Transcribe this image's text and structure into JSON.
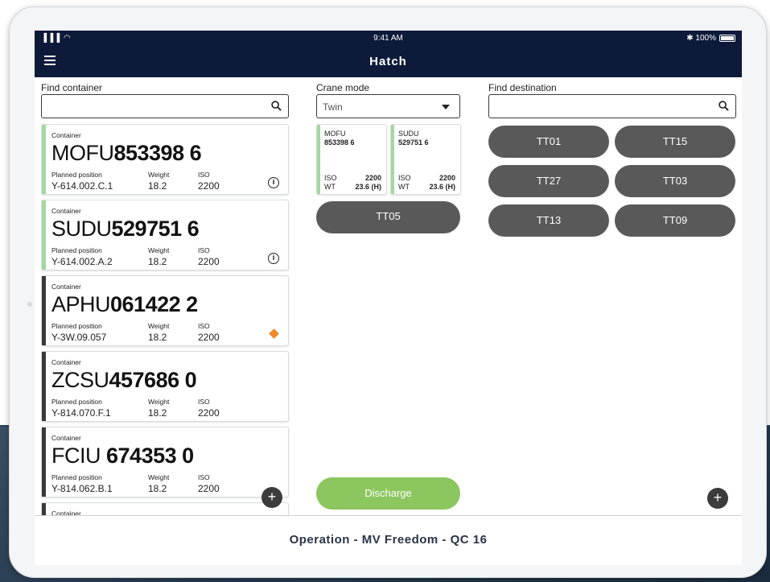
{
  "status": {
    "signal": "▐▐▐ ◠",
    "time": "9:41 AM",
    "battery": "✱ 100%"
  },
  "nav": {
    "title": "Hatch"
  },
  "find_container": {
    "label": "Find container",
    "value": ""
  },
  "containers": [
    {
      "caption": "Container",
      "prefix": "MOFU",
      "number": "853398 6",
      "status": "green",
      "pos_label": "Planned position",
      "pos": "Y-614.002.C.1",
      "weight_label": "Weight",
      "weight": "18.2",
      "iso_label": "ISO",
      "iso": "2200",
      "icon": "info-icon"
    },
    {
      "caption": "Container",
      "prefix": "SUDU",
      "number": "529751 6",
      "status": "green",
      "pos_label": "Planned position",
      "pos": "Y-614.002.A.2",
      "weight_label": "Weight",
      "weight": "18.2",
      "iso_label": "ISO",
      "iso": "2200",
      "icon": "info-icon"
    },
    {
      "caption": "Container",
      "prefix": "APHU",
      "number": "061422 2",
      "status": "dark",
      "pos_label": "Planned position",
      "pos": "Y-3W.09.057",
      "weight_label": "Weight",
      "weight": "18.2",
      "iso_label": "ISO",
      "iso": "2200",
      "icon": "diamond-icon"
    },
    {
      "caption": "Container",
      "prefix": "ZCSU",
      "number": "457686 0",
      "status": "dark",
      "pos_label": "Planned position",
      "pos": "Y-814.070.F.1",
      "weight_label": "Weight",
      "weight": "18.2",
      "iso_label": "ISO",
      "iso": "2200",
      "icon": ""
    },
    {
      "caption": "Container",
      "prefix": "FCIU",
      "number": "674353 0",
      "status": "dark",
      "pos_label": "Planned position",
      "pos": "Y-814.062.B.1",
      "weight_label": "Weight",
      "weight": "18.2",
      "iso_label": "ISO",
      "iso": "2200",
      "icon": ""
    },
    {
      "caption": "Container",
      "prefix": "",
      "number": "",
      "status": "dark",
      "pos_label": "",
      "pos": "",
      "weight_label": "",
      "weight": "",
      "iso_label": "",
      "iso": "",
      "icon": ""
    }
  ],
  "crane_mode": {
    "label": "Crane mode",
    "value": "Twin"
  },
  "twin_cards": [
    {
      "prefix": "MOFU",
      "number": "853398 6",
      "iso_label": "ISO",
      "iso": "2200",
      "wt_label": "WT",
      "wt": "23.6 (H)"
    },
    {
      "prefix": "SUDU",
      "number": "529751 6",
      "iso_label": "ISO",
      "iso": "2200",
      "wt_label": "WT",
      "wt": "23.6 (H)"
    }
  ],
  "assigned": "TT05",
  "discharge_label": "Discharge",
  "find_destination": {
    "label": "Find destination",
    "value": ""
  },
  "destinations": [
    "TT01",
    "TT15",
    "TT27",
    "TT03",
    "TT13",
    "TT09"
  ],
  "plus_label": "+",
  "footer": {
    "operation": "Operation - MV Freedom - QC 16"
  },
  "colors": {
    "navbar": "#0d1a3a",
    "ready": "#a5d8a0",
    "pending": "#3a3a3a",
    "discharge": "#8cc65e",
    "pill": "#595959",
    "warning": "#f08a2c"
  }
}
